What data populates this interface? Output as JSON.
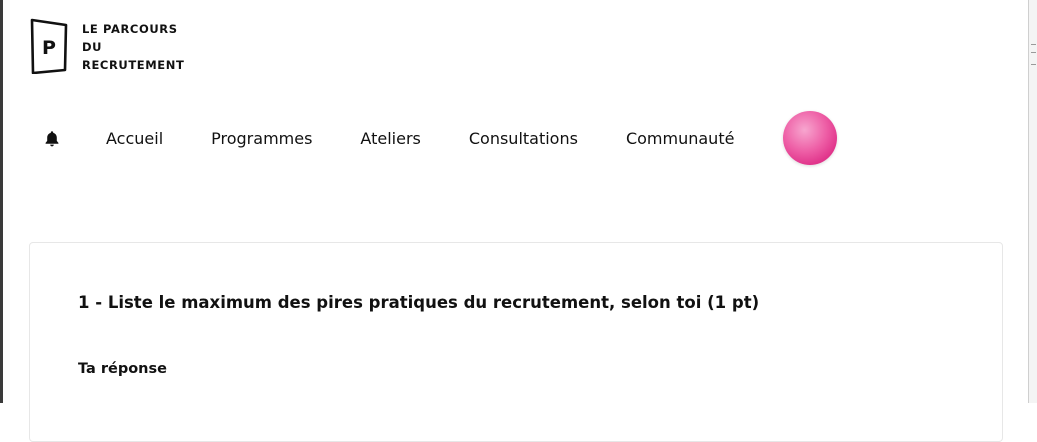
{
  "logo": {
    "lines": [
      "LE PARCOURS",
      "DU",
      "RECRUTEMENT"
    ],
    "mark_letter": "P"
  },
  "nav": {
    "items": [
      {
        "label": "Accueil"
      },
      {
        "label": "Programmes"
      },
      {
        "label": "Ateliers"
      },
      {
        "label": "Consultations"
      },
      {
        "label": "Communauté"
      }
    ],
    "bell_icon": "bell-icon"
  },
  "avatar": {
    "color": "#ee5fa6"
  },
  "question": {
    "title": "1 - Liste le maximum des pires pratiques du recrutement, selon toi (1 pt)",
    "answer_label": "Ta réponse"
  }
}
